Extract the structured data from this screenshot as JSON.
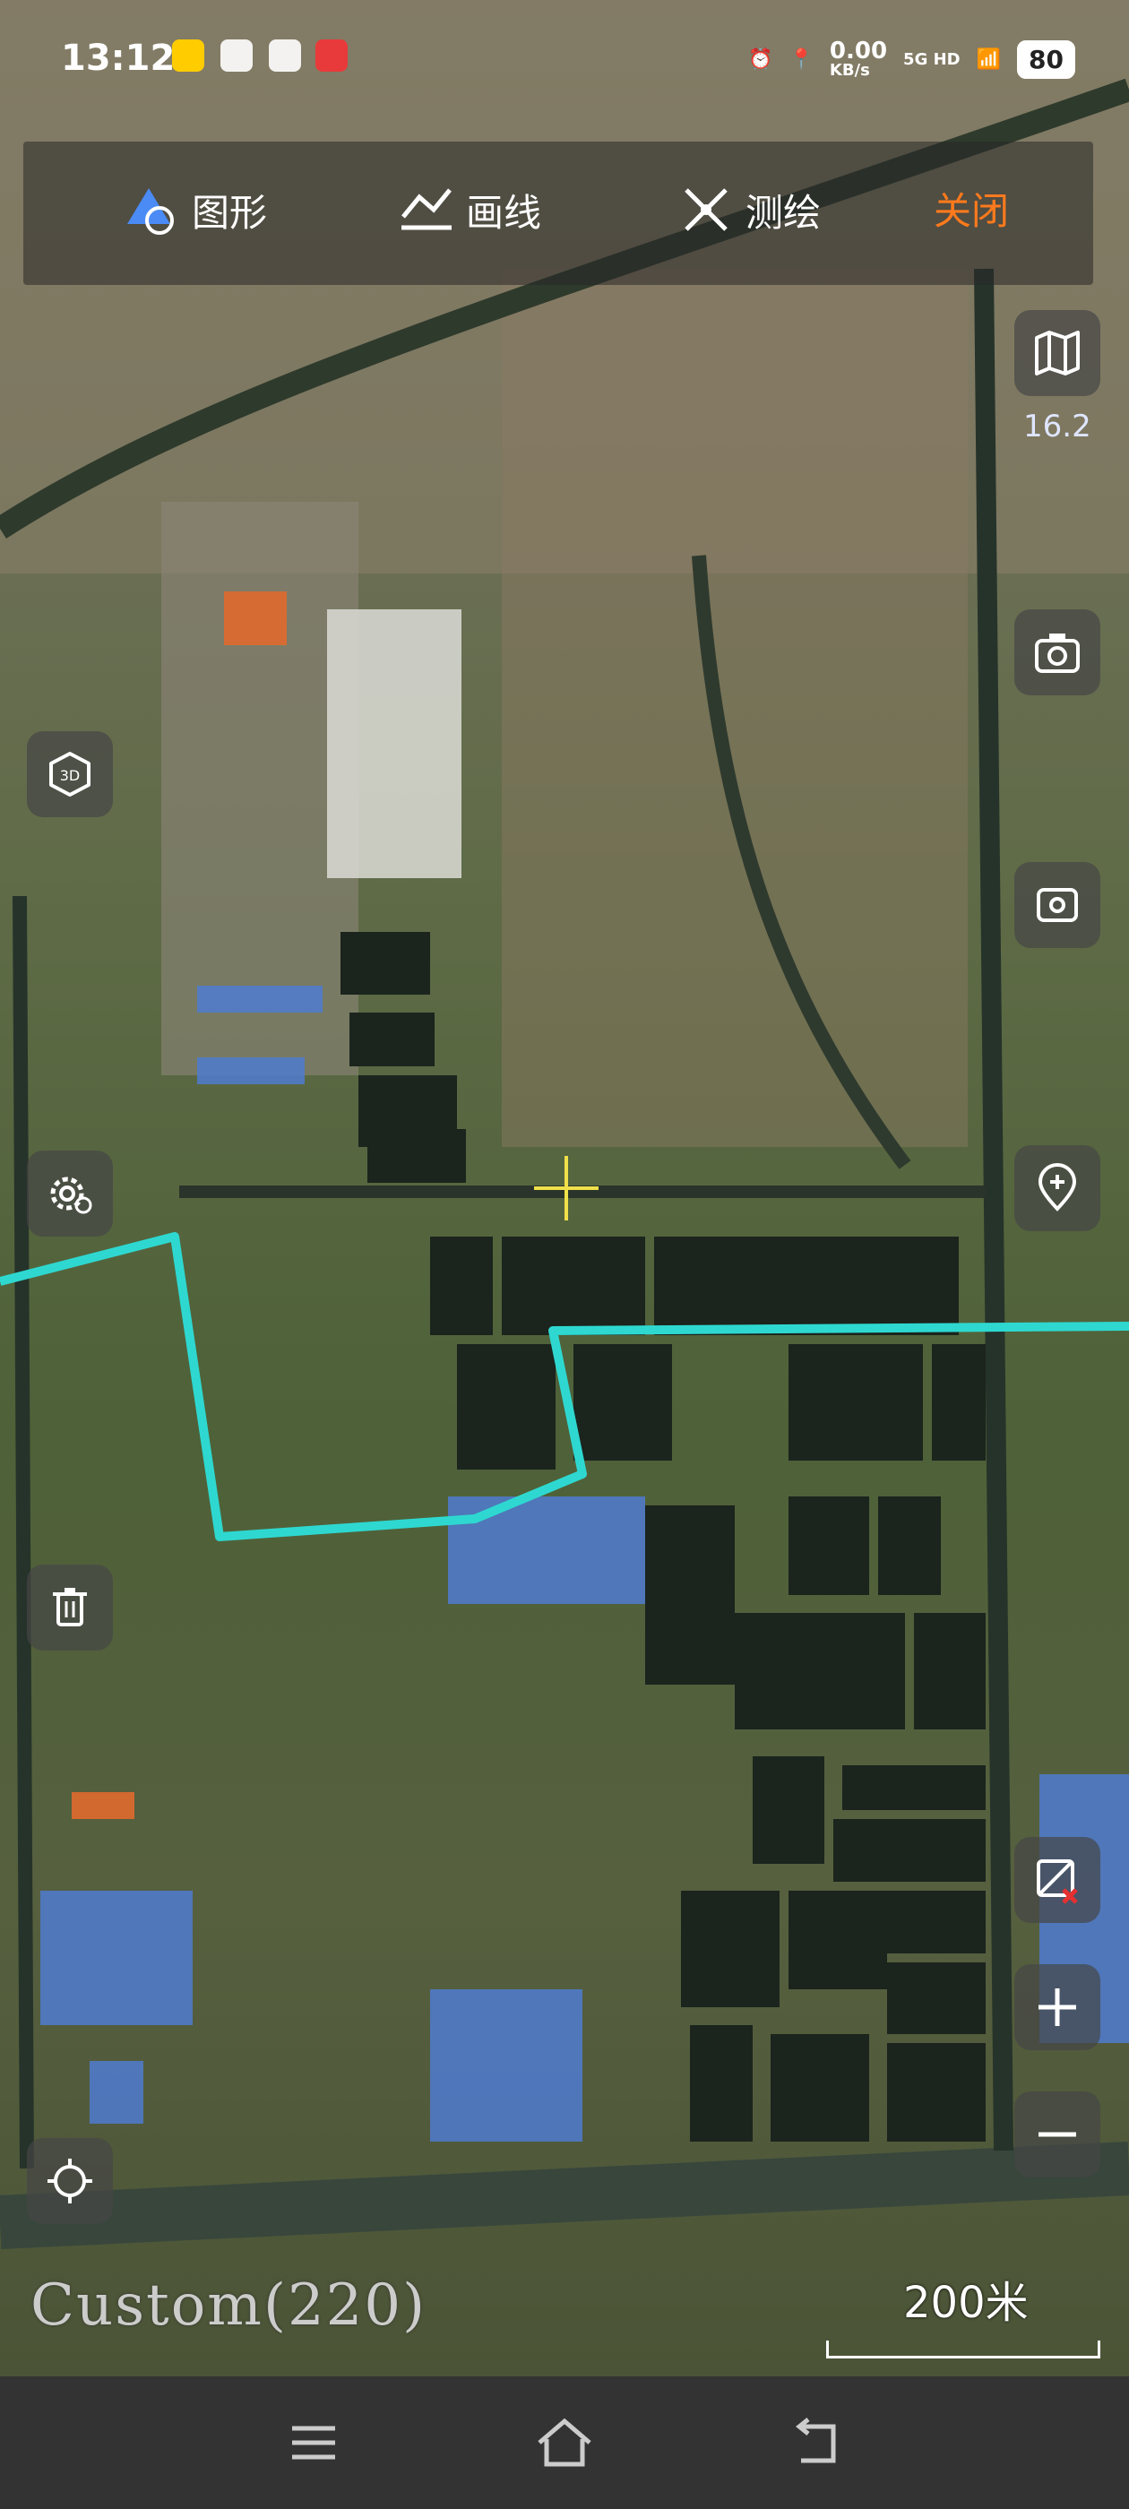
{
  "status": {
    "time": "13:12",
    "speed": "0.00",
    "speed_unit": "KB/s",
    "network": "5G HD",
    "battery": "80"
  },
  "toolbar": {
    "shape_label": "图形",
    "line_label": "画线",
    "survey_label": "测绘",
    "close_label": "关闭"
  },
  "map": {
    "zoom_level": "16.2",
    "layer_name": "Custom(220)",
    "scale_label": "200米",
    "route_color": "#2ed8d0"
  },
  "icons": {
    "layers": "map-layers-icon",
    "camera": "camera-icon",
    "rotate": "rotate-camera-icon",
    "location": "location-pin-icon",
    "three_d": "3d-cube-icon",
    "settings": "gear-icon",
    "delete": "trash-icon",
    "locate": "locate-target-icon",
    "clear": "clear-map-icon",
    "zoom_in": "plus-icon",
    "zoom_out": "minus-icon"
  }
}
